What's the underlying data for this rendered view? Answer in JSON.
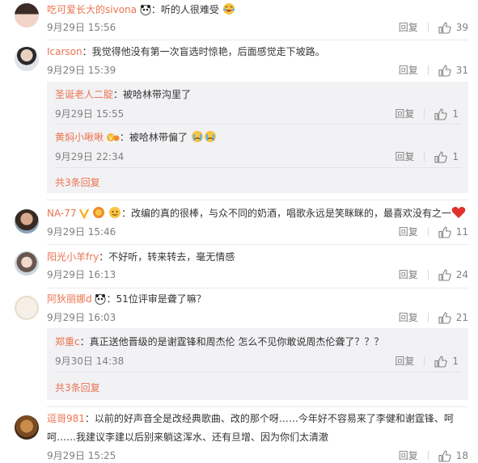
{
  "reply_label": "回复",
  "more_label": "共3条回复",
  "comments": [
    {
      "user": "吃可爱长大的sivona",
      "text": "：听的人很难受",
      "time": "9月29日 15:56",
      "likes": "39"
    },
    {
      "user": "Icarson",
      "text": "：我觉得他没有第一次盲选时惊艳，后面感觉走下坡路。",
      "time": "9月29日 15:39",
      "likes": "31",
      "replies": [
        {
          "user": "圣诞老人二腚",
          "text": "：被哈林带沟里了",
          "time": "9月29日 15:55",
          "likes": "1"
        },
        {
          "user": "黄焖小啾啾",
          "text": "：被哈林带偏了",
          "time": "9月29日 22:34",
          "likes": "1"
        }
      ]
    },
    {
      "user": "NA-77",
      "text": "：改编的真的很棒，与众不同的奶酒，唱歌永远是笑眯眯的，最喜欢没有之一",
      "time": "9月29日 15:46",
      "likes": "11"
    },
    {
      "user": "阳光小羊fry",
      "text": "：不好听，转来转去，毫无情感",
      "time": "9月29日 16:13",
      "likes": "24"
    },
    {
      "user": "阿狄丽娜d",
      "text": "：51位评审是聋了嘛？",
      "time": "9月29日 16:03",
      "likes": "21",
      "replies": [
        {
          "user": "郑重c",
          "text": "：真正送他晋级的是谢霆锋和周杰伦 怎么不见你敢说周杰伦聋了？？？",
          "time": "9月30日 14:38",
          "likes": "1"
        }
      ]
    },
    {
      "user": "逗哥981",
      "text": "：以前的好声音全是改经典歌曲、改的那个呀……今年好不容易来了李健和谢霆锋、呵",
      "text2": "呵……我建议李建以后别来躺这浑水、还有旦增、因为你们太清澈",
      "time": "9月29日 15:25",
      "likes": "18"
    }
  ],
  "colors": {
    "username": "#eb7350",
    "meta": "#808080",
    "reply_bg": "#f2f2f5"
  },
  "icons": [
    "thumbs-up-icon",
    "panda-emoji-icon",
    "laughing-emoji-icon",
    "crying-emoji-icon",
    "heart-emoji-icon",
    "verified-v-icon"
  ]
}
